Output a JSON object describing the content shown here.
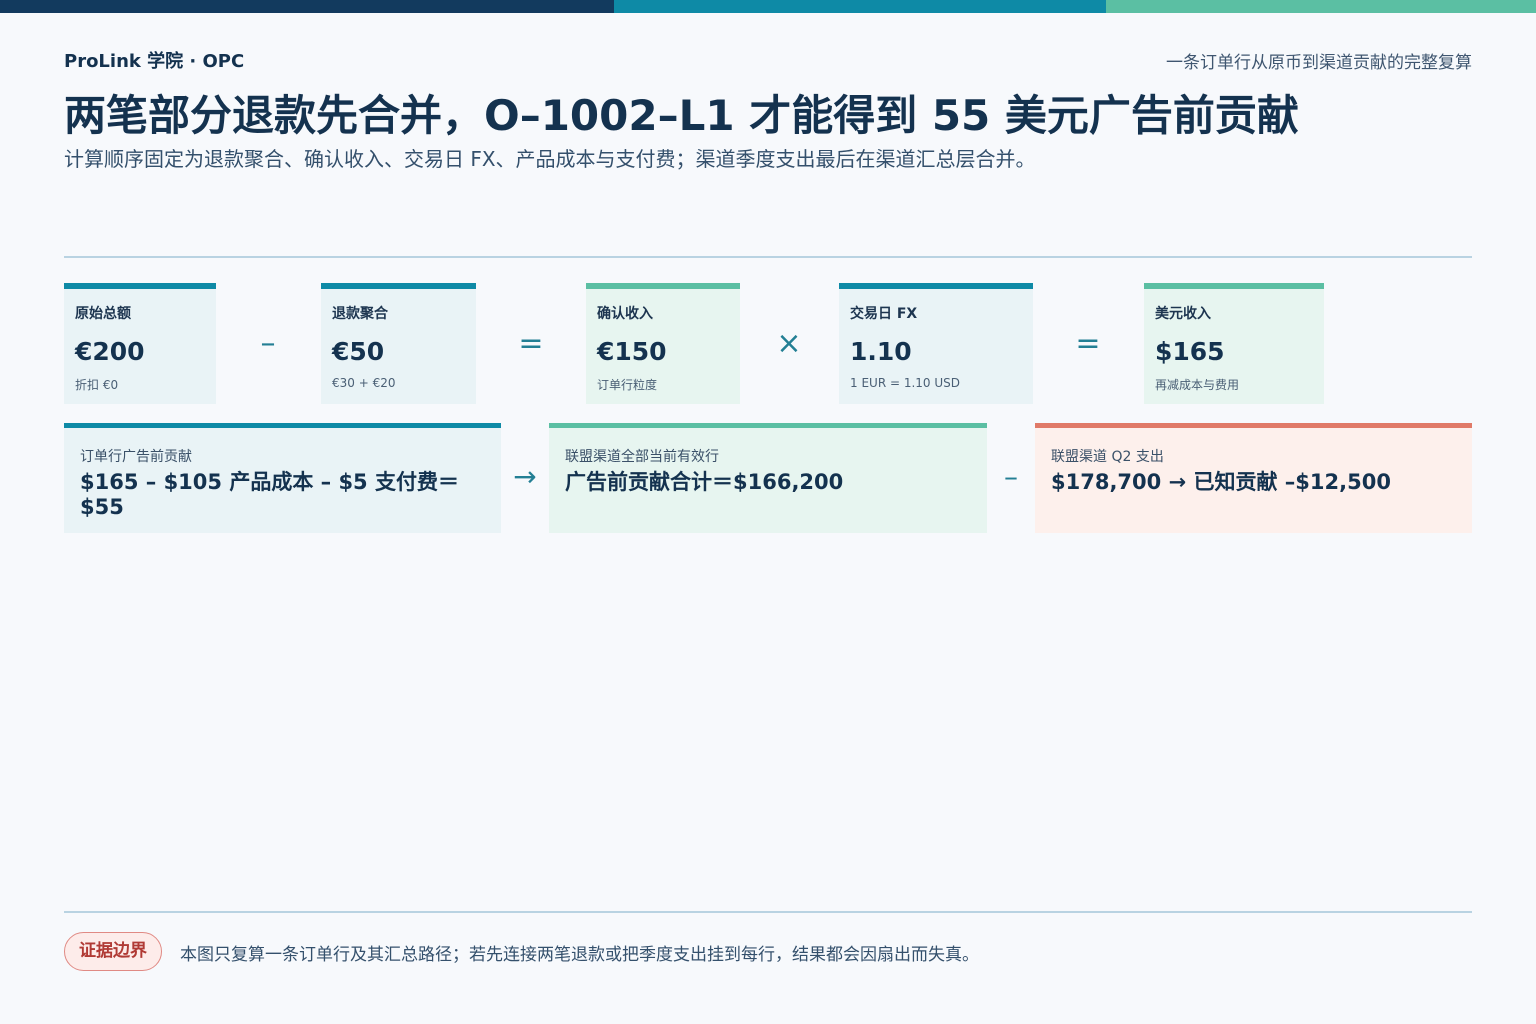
{
  "colors": {
    "navy": "#14324f",
    "teal": "#0e8aa6",
    "mint": "#5bbfa3",
    "salmon": "#e07a68",
    "card_blue_bg": "#e9f3f6",
    "card_green_bg": "#e7f5f0",
    "card_red_bg": "#fdf0ec"
  },
  "header": {
    "brand": "ProLink 学院 · OPC",
    "tagline": "一条订单行从原币到渠道贡献的完整复算",
    "title": "两笔部分退款先合并，O–1002–L1 才能得到 55 美元广告前贡献",
    "subtitle": "计算顺序固定为退款聚合、确认收入、交易日 FX、产品成本与支付费；渠道季度支出最后在渠道汇总层合并。"
  },
  "flow_row1": {
    "cards": [
      {
        "label": "原始总额",
        "value": "€200",
        "note": "折扣 €0"
      },
      {
        "label": "退款聚合",
        "value": "€50",
        "note": "€30 + €20"
      },
      {
        "label": "确认收入",
        "value": "€150",
        "note": "订单行粒度"
      },
      {
        "label": "交易日 FX",
        "value": "1.10",
        "note": "1 EUR = 1.10 USD"
      },
      {
        "label": "美元收入",
        "value": "$165",
        "note": "再减成本与费用"
      }
    ],
    "operators": [
      "–",
      "=",
      "×",
      "="
    ]
  },
  "flow_row2": {
    "cards": [
      {
        "label": "订单行广告前贡献",
        "value": "$165 – $105 产品成本 – $5 支付费＝$55"
      },
      {
        "label": "联盟渠道全部当前有效行",
        "value": "广告前贡献合计＝$166,200"
      },
      {
        "label": "联盟渠道 Q2 支出",
        "value": "$178,700 → 已知贡献 –$12,500"
      }
    ],
    "operators": [
      "→",
      "–"
    ]
  },
  "footer": {
    "badge": "证据边界",
    "note": "本图只复算一条订单行及其汇总路径；若先连接两笔退款或把季度支出挂到每行，结果都会因扇出而失真。"
  }
}
